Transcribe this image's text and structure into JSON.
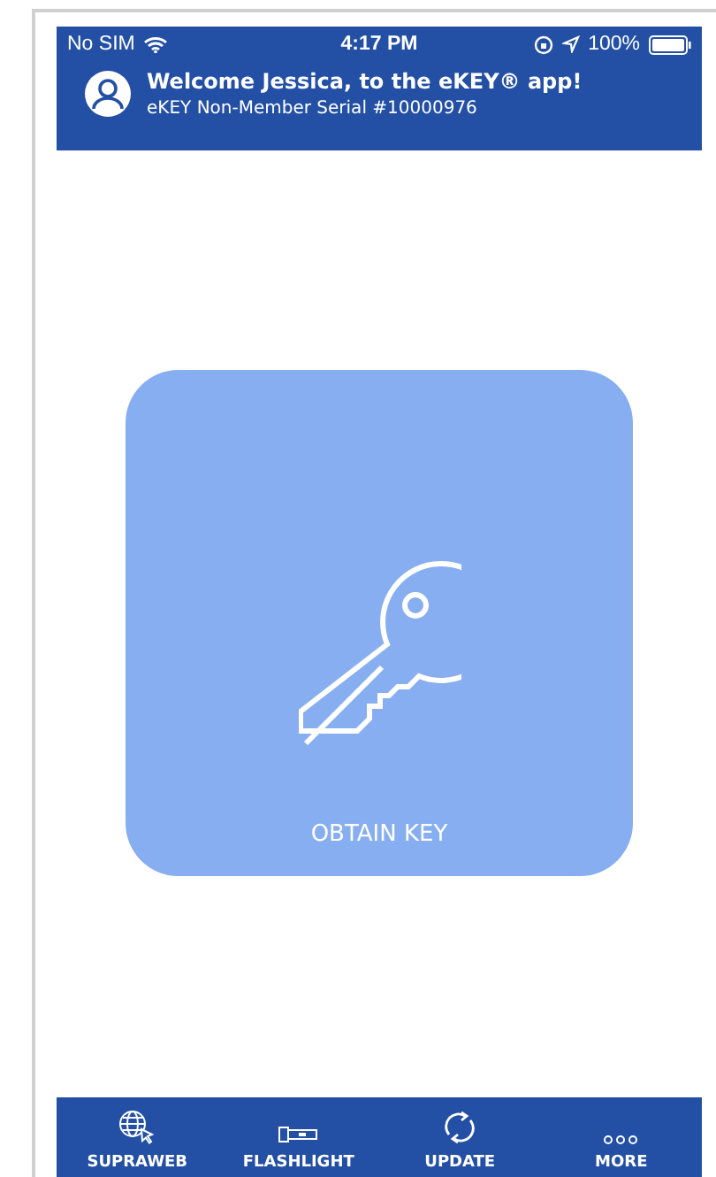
{
  "status_bar": {
    "carrier": "No SIM",
    "time": "4:17 PM",
    "battery": "100%"
  },
  "header": {
    "title": "Welcome Jessica, to the eKEY® app!",
    "subtitle": "eKEY Non-Member Serial #10000976"
  },
  "main_action": {
    "label": "OBTAIN KEY"
  },
  "tab_bar": [
    {
      "label": "SUPRAWEB",
      "kind": "globe"
    },
    {
      "label": "FLASHLIGHT",
      "kind": "flashlight"
    },
    {
      "label": "UPDATE",
      "kind": "sync"
    },
    {
      "label": "MORE",
      "kind": "more"
    }
  ]
}
